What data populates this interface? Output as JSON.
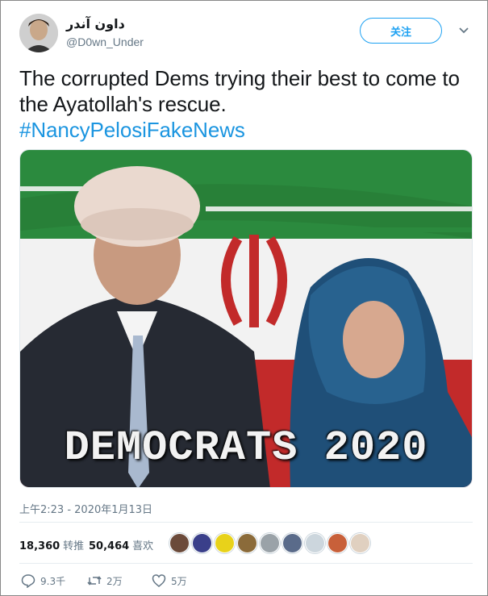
{
  "user": {
    "display_name": "داون آندر",
    "handle": "@D0wn_Under",
    "follow_label": "关注"
  },
  "tweet": {
    "text": "The corrupted Dems trying their best to come to the Ayatollah's rescue.",
    "hashtag": "#NancyPelosiFakeNews",
    "image_caption": "DEMOCRATS 2020",
    "timestamp": "上午2:23 - 2020年1月13日"
  },
  "stats": {
    "retweets_count": "18,360",
    "retweets_label": "转推",
    "likes_count": "50,464",
    "likes_label": "喜欢"
  },
  "likers": [
    {
      "color": "#6b4a3a"
    },
    {
      "color": "#3a3f8a"
    },
    {
      "color": "#e8d21a"
    },
    {
      "color": "#8b6b3a"
    },
    {
      "color": "#9aa2a8"
    },
    {
      "color": "#5a6b8a"
    },
    {
      "color": "#ccd6dd"
    },
    {
      "color": "#c8603a"
    },
    {
      "color": "#e0d0c0"
    }
  ],
  "actions": {
    "reply_count": "9.3千",
    "retweet_count": "2万",
    "like_count": "5万"
  },
  "colors": {
    "accent": "#1da1f2",
    "hashtag": "#1b95e0",
    "muted": "#657786"
  }
}
